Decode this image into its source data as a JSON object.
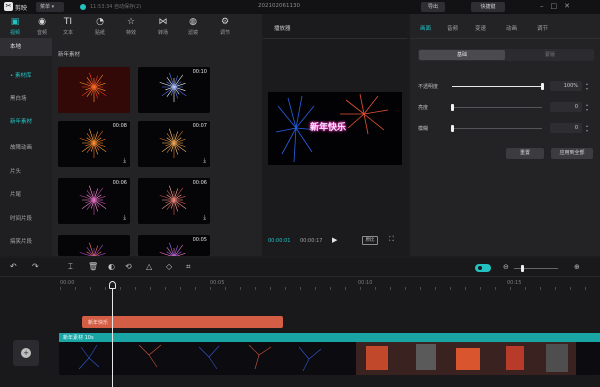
{
  "titlebar": {
    "app_logo": "✂",
    "app_name": "剪映",
    "menu_label": "菜单 ▾",
    "autosave_text": "11:53:34 自动保存(2)",
    "project_title": "202102061130",
    "export_label": "导出",
    "shortcut_label": "快捷键"
  },
  "toolbar": {
    "items": [
      {
        "label": "视频",
        "icon": "film-icon",
        "glyph": "▣",
        "active": true
      },
      {
        "label": "音频",
        "icon": "audio-icon",
        "glyph": "◉"
      },
      {
        "label": "文本",
        "icon": "text-icon",
        "glyph": "TI"
      },
      {
        "label": "贴纸",
        "icon": "sticker-icon",
        "glyph": "◔"
      },
      {
        "label": "特效",
        "icon": "effects-icon",
        "glyph": "☆"
      },
      {
        "label": "转场",
        "icon": "transition-icon",
        "glyph": "⋈"
      },
      {
        "label": "滤镜",
        "icon": "filter-icon",
        "glyph": "◍"
      },
      {
        "label": "调节",
        "icon": "adjust-icon",
        "glyph": "⚙"
      }
    ]
  },
  "sidebar": {
    "items": [
      {
        "label": "本地",
        "state": "selected"
      },
      {
        "label": "• 素材库",
        "state": "active"
      },
      {
        "label": "黑白场"
      },
      {
        "label": "新年素材",
        "state": "active"
      },
      {
        "label": "故障动画"
      },
      {
        "label": "片头"
      },
      {
        "label": "片尾"
      },
      {
        "label": "时间片段"
      },
      {
        "label": "搞笑片段"
      }
    ]
  },
  "library": {
    "section_title": "新年素材",
    "thumbs": [
      {
        "duration": ""
      },
      {
        "duration": "00:10"
      },
      {
        "duration": "00:08"
      },
      {
        "duration": "00:07"
      },
      {
        "duration": "00:06"
      },
      {
        "duration": "00:06"
      },
      {
        "duration": ""
      },
      {
        "duration": "00:05"
      }
    ],
    "download_glyph": "⤓"
  },
  "player": {
    "label": "播放器",
    "caption": "新年快乐",
    "time_current": "00:00:01",
    "time_total": "00:00:17",
    "play_glyph": "▶",
    "ratio_label": "原比",
    "fullscreen_glyph": "⛶"
  },
  "inspector": {
    "tabs": [
      {
        "label": "画面",
        "active": true
      },
      {
        "label": "音频"
      },
      {
        "label": "变速"
      },
      {
        "label": "动画"
      },
      {
        "label": "调节"
      }
    ],
    "segment_basic": "基础",
    "segment_mask": "蒙版",
    "props": [
      {
        "label": "不透明度",
        "value": "100%",
        "fraction": 1.0
      },
      {
        "label": "亮度",
        "value": "0",
        "fraction": 0.0
      },
      {
        "label": "模糊",
        "value": "0",
        "fraction": 0.0
      }
    ],
    "reset_label": "重置",
    "apply_all_label": "应用到全部"
  },
  "timeline": {
    "tools": [
      {
        "glyph": "↶",
        "icon": "undo-icon"
      },
      {
        "glyph": "↷",
        "icon": "redo-icon"
      },
      {
        "glyph": "⌶",
        "icon": "split-icon"
      },
      {
        "glyph": "🗑",
        "icon": "delete-icon"
      },
      {
        "glyph": "◐",
        "icon": "freeze-icon"
      },
      {
        "glyph": "⟲",
        "icon": "reverse-icon"
      },
      {
        "glyph": "△",
        "icon": "mirror-icon"
      },
      {
        "glyph": "◇",
        "icon": "rotate-icon"
      },
      {
        "glyph": "⌗",
        "icon": "crop-icon"
      }
    ],
    "zoom_out_glyph": "⊖",
    "zoom_in_glyph": "⊕",
    "zoom_fraction": 0.15,
    "ruler": [
      "00:00",
      "00:05",
      "00:10",
      "00:15"
    ],
    "text_clip_label": "新年快乐",
    "video_clip_label": "新年素材 10s",
    "cover_glyph": "+"
  }
}
